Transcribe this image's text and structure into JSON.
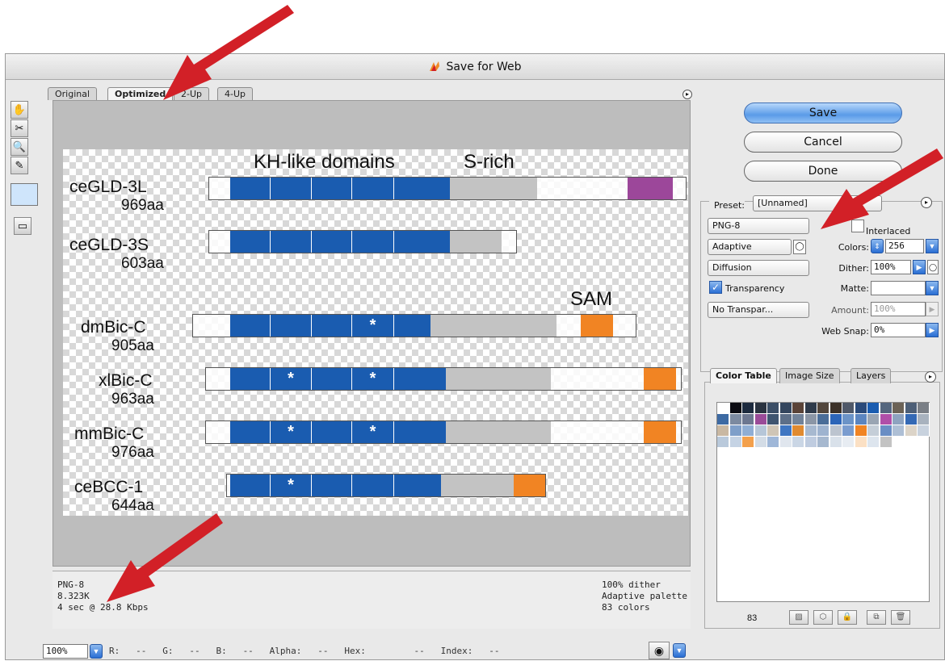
{
  "window": {
    "title": "Save for Web"
  },
  "tabs": [
    "Original",
    "Optimized",
    "2-Up",
    "4-Up"
  ],
  "canvas": {
    "headers": {
      "kh": "KH-like domains",
      "srich": "S-rich",
      "sam": "SAM"
    },
    "proteins": [
      {
        "prefix": "ce",
        "name": "GLD-3L",
        "length": "969aa"
      },
      {
        "prefix": "ce",
        "name": "GLD-3S",
        "length": "603aa"
      },
      {
        "prefix": "dm",
        "name": "Bic-C",
        "length": "905aa"
      },
      {
        "prefix": "xl",
        "name": "Bic-C",
        "length": "963aa"
      },
      {
        "prefix": "mm",
        "name": "Bic-C",
        "length": "976aa"
      },
      {
        "prefix": "ce",
        "name": "BCC-1",
        "length": "644aa"
      }
    ],
    "star": "*"
  },
  "status_left": {
    "format": "PNG-8",
    "size": "8.323K",
    "time": "4 sec @ 28.8 Kbps"
  },
  "status_right": {
    "dither": "100% dither",
    "palette": "Adaptive palette",
    "colors": "83 colors"
  },
  "bottom": {
    "zoom": "100%",
    "readout": "R:   --   G:   --   B:   --   Alpha:   --   Hex:         --   Index:   --"
  },
  "buttons": {
    "save": "Save",
    "cancel": "Cancel",
    "done": "Done"
  },
  "settings": {
    "preset_label": "Preset:",
    "preset_value": "[Unnamed]",
    "format": "PNG-8",
    "interlaced_label": "Interlaced",
    "reduction": "Adaptive",
    "colors_label": "Colors:",
    "colors_value": "256",
    "dither_algo": "Diffusion",
    "dither_label": "Dither:",
    "dither_value": "100%",
    "transparency_label": "Transparency",
    "matte_label": "Matte:",
    "transparency_dither": "No Transpar...",
    "amount_label": "Amount:",
    "amount_value": "100%",
    "websnap_label": "Web Snap:",
    "websnap_value": "0%"
  },
  "color_table": {
    "tabs": [
      "Color Table",
      "Image Size",
      "Layers"
    ],
    "count": "83",
    "colors": [
      "#ffffff",
      "#0b0b12",
      "#1c2a3e",
      "#2a3340",
      "#3b4e66",
      "#34465e",
      "#5a4338",
      "#2f3b4b",
      "#52463c",
      "#3c3128",
      "#4f5868",
      "#2a4a7a",
      "#1a5cb0",
      "#54667e",
      "#6b6256",
      "#4d5f77",
      "#7a7f86",
      "#3d6aa3",
      "#7c8aa0",
      "#6c7790",
      "#9a4b98",
      "#3f5570",
      "#5d6f88",
      "#728399",
      "#8b96a6",
      "#4a6d98",
      "#2c65b8",
      "#6b93c7",
      "#5b85c0",
      "#9aa5b3",
      "#b04fa8",
      "#8ea3c0",
      "#3469b5",
      "#a8b2be",
      "#c9b8a2",
      "#7f9fc9",
      "#90aed4",
      "#b6c6d8",
      "#cfc5b6",
      "#3f76c2",
      "#e08a30",
      "#a7b9d0",
      "#9eb3cf",
      "#bcc4cf",
      "#7a9ccf",
      "#f18423",
      "#c5ced8",
      "#6a8ec4",
      "#aebfd5",
      "#dcd4c8",
      "#c8d2de",
      "#b9c9db",
      "#c5d3e4",
      "#f3a04c",
      "#d3dce6",
      "#9fb7d8",
      "#e0e6ee",
      "#cad6e5",
      "#bfcce0",
      "#a6b8cf",
      "#d9e1ea",
      "#e7ecf2",
      "#fbe0c4",
      "#dde5ee",
      "#c3c3c3"
    ]
  },
  "accent": {
    "kh_blue": "#1a5cb0",
    "srich_gray": "#c3c3c3",
    "sam_orange": "#f18423",
    "sam_purple": "#9c479a",
    "arrow_red": "#d22027"
  }
}
